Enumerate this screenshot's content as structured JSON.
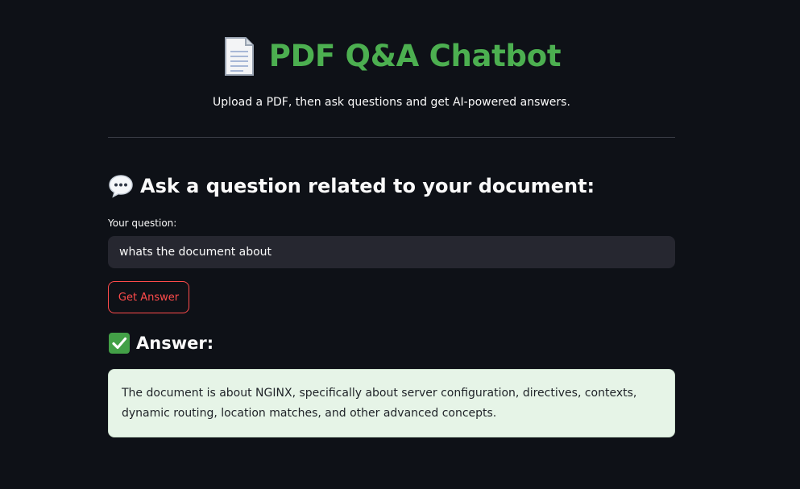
{
  "header": {
    "icon": "document-icon",
    "title": "PDF Q&A Chatbot",
    "subtitle": "Upload a PDF, then ask questions and get AI-powered answers."
  },
  "question_section": {
    "icon": "speech-bubble-icon",
    "heading": "Ask a question related to your document:",
    "label": "Your question:",
    "value": "whats the document about",
    "button_label": "Get Answer"
  },
  "answer_section": {
    "icon": "checkmark-icon",
    "heading": "Answer:",
    "text": "The document is about NGINX, specifically about server configuration, directives, contexts, dynamic routing, location matches, and other advanced concepts."
  },
  "colors": {
    "background": "#0e1117",
    "title": "#4caf50",
    "button_accent": "#ff4b4b",
    "input_background": "#262730",
    "answer_background": "#e6f4e7"
  }
}
